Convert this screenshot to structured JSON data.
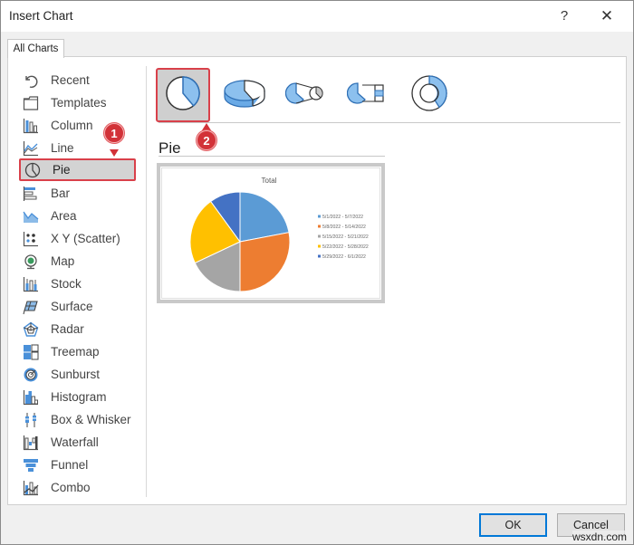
{
  "window": {
    "title": "Insert Chart",
    "help_glyph": "?",
    "close_glyph": "✕"
  },
  "tabs": [
    {
      "label": "All Charts",
      "active": true
    }
  ],
  "sidebar": {
    "items": [
      {
        "label": "Recent",
        "icon": "recent-icon"
      },
      {
        "label": "Templates",
        "icon": "templates-icon"
      },
      {
        "label": "Column",
        "icon": "column-chart-icon"
      },
      {
        "label": "Line",
        "icon": "line-chart-icon"
      },
      {
        "label": "Pie",
        "icon": "pie-chart-icon",
        "selected": true
      },
      {
        "label": "Bar",
        "icon": "bar-chart-icon"
      },
      {
        "label": "Area",
        "icon": "area-chart-icon"
      },
      {
        "label": "X Y (Scatter)",
        "icon": "scatter-chart-icon"
      },
      {
        "label": "Map",
        "icon": "map-chart-icon"
      },
      {
        "label": "Stock",
        "icon": "stock-chart-icon"
      },
      {
        "label": "Surface",
        "icon": "surface-chart-icon"
      },
      {
        "label": "Radar",
        "icon": "radar-chart-icon"
      },
      {
        "label": "Treemap",
        "icon": "treemap-chart-icon"
      },
      {
        "label": "Sunburst",
        "icon": "sunburst-chart-icon"
      },
      {
        "label": "Histogram",
        "icon": "histogram-chart-icon"
      },
      {
        "label": "Box & Whisker",
        "icon": "box-whisker-chart-icon"
      },
      {
        "label": "Waterfall",
        "icon": "waterfall-chart-icon"
      },
      {
        "label": "Funnel",
        "icon": "funnel-chart-icon"
      },
      {
        "label": "Combo",
        "icon": "combo-chart-icon"
      }
    ]
  },
  "subtypes": [
    {
      "name": "Pie",
      "icon": "pie-subtype-icon",
      "selected": true
    },
    {
      "name": "3-D Pie",
      "icon": "pie-3d-subtype-icon"
    },
    {
      "name": "Pie of Pie",
      "icon": "pie-of-pie-subtype-icon"
    },
    {
      "name": "Bar of Pie",
      "icon": "bar-of-pie-subtype-icon"
    },
    {
      "name": "Doughnut",
      "icon": "doughnut-subtype-icon"
    }
  ],
  "selected_subtype_name": "Pie",
  "annotations": {
    "step1": "1",
    "step2": "2"
  },
  "chart_data": {
    "type": "pie",
    "title": "Total",
    "categories": [
      "5/1/2022 - 5/7/2022",
      "5/8/2022 - 5/14/2022",
      "5/15/2022 - 5/21/2022",
      "5/22/2022 - 5/28/2022",
      "5/29/2022 - 6/1/2022"
    ],
    "values": [
      22,
      28,
      18,
      22,
      10
    ],
    "colors": [
      "#5b9bd5",
      "#ed7d31",
      "#a5a5a5",
      "#ffc000",
      "#4472c4"
    ],
    "legend": "right"
  },
  "footer": {
    "ok_label": "OK",
    "cancel_label": "Cancel"
  },
  "watermark": "wsxdn.com",
  "colors": {
    "highlight_border": "#d9404a",
    "badge": "#d23238",
    "ok_focus": "#0078d7"
  }
}
